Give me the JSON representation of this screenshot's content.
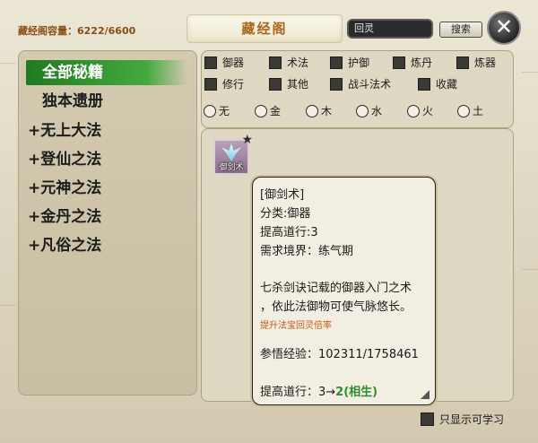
{
  "header": {
    "capacity_label": "藏经阁容量：",
    "capacity_value": "6222/6600",
    "title": "藏经阁",
    "search_value": "回灵",
    "search_button": "搜索",
    "close_icon": "✕"
  },
  "categories": [
    {
      "label": "全部秘籍",
      "active": true
    },
    {
      "label": "独本遗册",
      "active": false
    },
    {
      "label": "+无上大法",
      "active": false
    },
    {
      "label": "+登仙之法",
      "active": false
    },
    {
      "label": "+元神之法",
      "active": false
    },
    {
      "label": "+金丹之法",
      "active": false
    },
    {
      "label": "+凡俗之法",
      "active": false
    }
  ],
  "filters": {
    "types": [
      "御器",
      "术法",
      "护御",
      "炼丹",
      "炼器",
      "修行",
      "其他",
      "战斗法术",
      "收藏"
    ],
    "elements": [
      "无",
      "金",
      "木",
      "水",
      "火",
      "土"
    ]
  },
  "book": {
    "label": "御剑术",
    "icon": "flying-sword-icon",
    "star_icon": "★"
  },
  "tooltip": {
    "name": "[御剑术]",
    "category": "分类:御器",
    "boost": "提高道行:3",
    "realm": "需求境界：练气期",
    "desc1": "七杀剑诀记载的御器入门之术",
    "desc2": "，依此法御物可使气脉悠长。",
    "effect": "提升法宝回灵倍率",
    "exp": "参悟经验：102311/1758461",
    "boost_prefix": "提高道行：3→",
    "boost_value": "2(相生)"
  },
  "learnable_label": "只显示可学习",
  "colors": {
    "active_category": "#2f8f2d",
    "title": "#a9661e",
    "capacity": "#8a4d14",
    "effect_text": "#c9580c",
    "boost_green": "#2e8b2e"
  }
}
